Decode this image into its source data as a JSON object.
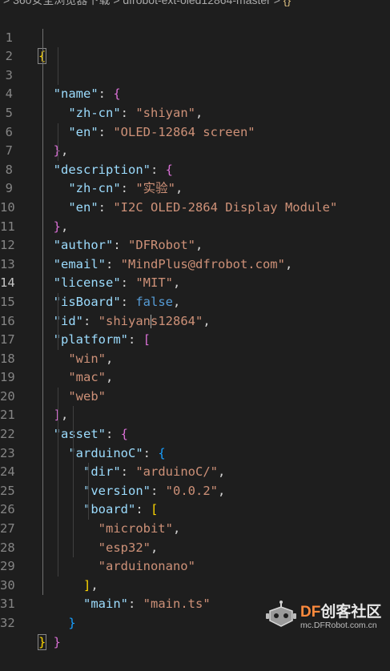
{
  "breadcrumb": {
    "text": "> 360安全浏览器下载 > dfrobot-ext-oled12864-master > "
  },
  "editor": {
    "lines": [
      {
        "n": "1"
      },
      {
        "n": "2"
      },
      {
        "n": "3"
      },
      {
        "n": "4"
      },
      {
        "n": "5"
      },
      {
        "n": "6"
      },
      {
        "n": "7"
      },
      {
        "n": "8"
      },
      {
        "n": "9"
      },
      {
        "n": "10"
      },
      {
        "n": "11"
      },
      {
        "n": "12"
      },
      {
        "n": "13"
      },
      {
        "n": "14"
      },
      {
        "n": "15"
      },
      {
        "n": "16"
      },
      {
        "n": "17"
      },
      {
        "n": "18"
      },
      {
        "n": "19"
      },
      {
        "n": "20"
      },
      {
        "n": "21"
      },
      {
        "n": "22"
      },
      {
        "n": "23"
      },
      {
        "n": "24"
      },
      {
        "n": "25"
      },
      {
        "n": "26"
      },
      {
        "n": "27"
      },
      {
        "n": "28"
      },
      {
        "n": "29"
      },
      {
        "n": "30"
      },
      {
        "n": "31"
      },
      {
        "n": "32"
      }
    ],
    "active_line": "14",
    "json": {
      "name_key": "\"name\"",
      "zhcn_key": "\"zh-cn\"",
      "en_key": "\"en\"",
      "name_zhcn": "\"shiyan\"",
      "name_en": "\"OLED-12864 screen\"",
      "description_key": "\"description\"",
      "desc_zhcn": "\"实验\"",
      "desc_en": "\"I2C OLED-2864 Display Module\"",
      "author_key": "\"author\"",
      "author_val": "\"DFRobot\"",
      "email_key": "\"email\"",
      "email_val": "\"MindPlus@dfrobot.com\"",
      "license_key": "\"license\"",
      "license_val": "\"MIT\"",
      "isboard_key": "\"isBoard\"",
      "isboard_val": "false",
      "id_key": "\"id\"",
      "id_val_a": "\"shiyan",
      "id_val_b": "s12864\"",
      "platform_key": "\"platform\"",
      "platform_win": "\"win\"",
      "platform_mac": "\"mac\"",
      "platform_web": "\"web\"",
      "asset_key": "\"asset\"",
      "arduinoc_key": "\"arduinoC\"",
      "dir_key": "\"dir\"",
      "dir_val": "\"arduinoC/\"",
      "version_key": "\"version\"",
      "version_val": "\"0.0.2\"",
      "board_key": "\"board\"",
      "board_microbit": "\"microbit\"",
      "board_esp32": "\"esp32\"",
      "board_arduinonano": "\"arduinonano\"",
      "main_key": "\"main\"",
      "main_val": "\"main.ts\""
    }
  },
  "watermark": {
    "brand_df": "DF",
    "brand_cn": "创客社区",
    "url": "mc.DFRobot.com.cn"
  }
}
